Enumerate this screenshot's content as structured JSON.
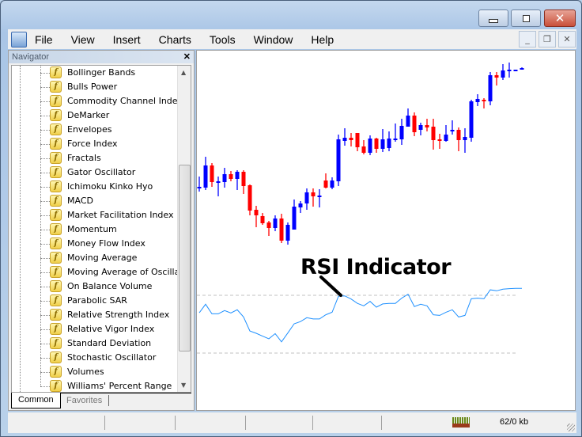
{
  "window": {
    "controls": [
      "minimize",
      "maximize",
      "close"
    ]
  },
  "menu": [
    "File",
    "View",
    "Insert",
    "Charts",
    "Tools",
    "Window",
    "Help"
  ],
  "navigator": {
    "title": "Navigator",
    "items": [
      "Bollinger Bands",
      "Bulls Power",
      "Commodity Channel Index",
      "DeMarker",
      "Envelopes",
      "Force Index",
      "Fractals",
      "Gator Oscillator",
      "Ichimoku Kinko Hyo",
      "MACD",
      "Market Facilitation Index",
      "Momentum",
      "Money Flow Index",
      "Moving Average",
      "Moving Average of Oscillat",
      "On Balance Volume",
      "Parabolic SAR",
      "Relative Strength Index",
      "Relative Vigor Index",
      "Standard Deviation",
      "Stochastic Oscillator",
      "Volumes",
      "Williams' Percent Range"
    ],
    "tabs": [
      "Common",
      "Favorites"
    ],
    "active_tab": "Common"
  },
  "chart": {
    "annotation": "RSI Indicator",
    "colors": {
      "bull": "#0000ff",
      "bear": "#ff0000",
      "rsi": "#1e90ff",
      "level": "#c0c0c0"
    },
    "candles_ohlc": [
      [
        165,
        178,
        159,
        165
      ],
      [
        164,
        203,
        161,
        192
      ],
      [
        192,
        195,
        165,
        171
      ],
      [
        172,
        178,
        153,
        172
      ],
      [
        171,
        189,
        164,
        181
      ],
      [
        181,
        185,
        172,
        175
      ],
      [
        175,
        186,
        161,
        184
      ],
      [
        184,
        186,
        156,
        166
      ],
      [
        167,
        168,
        129,
        135
      ],
      [
        136,
        141,
        114,
        129
      ],
      [
        128,
        132,
        117,
        119
      ],
      [
        120,
        122,
        103,
        113
      ],
      [
        113,
        129,
        109,
        125
      ],
      [
        125,
        131,
        94,
        97
      ],
      [
        97,
        120,
        92,
        117
      ],
      [
        111,
        149,
        111,
        140
      ],
      [
        139,
        147,
        132,
        144
      ],
      [
        144,
        163,
        136,
        158
      ],
      [
        158,
        163,
        140,
        153
      ],
      [
        154,
        162,
        139,
        154
      ],
      [
        173,
        182,
        163,
        164
      ],
      [
        164,
        177,
        162,
        173
      ],
      [
        172,
        231,
        166,
        225
      ],
      [
        223,
        239,
        217,
        227
      ],
      [
        227,
        233,
        216,
        224
      ],
      [
        233,
        233,
        210,
        215
      ],
      [
        216,
        224,
        206,
        208
      ],
      [
        208,
        230,
        205,
        226
      ],
      [
        226,
        227,
        208,
        213
      ],
      [
        213,
        238,
        209,
        225
      ],
      [
        214,
        235,
        210,
        226
      ],
      [
        226,
        245,
        222,
        226
      ],
      [
        225,
        251,
        218,
        242
      ],
      [
        241,
        264,
        241,
        255
      ],
      [
        255,
        259,
        229,
        234
      ],
      [
        237,
        246,
        230,
        243
      ],
      [
        243,
        251,
        235,
        240
      ],
      [
        241,
        251,
        212,
        224
      ],
      [
        225,
        232,
        213,
        223
      ],
      [
        223,
        243,
        222,
        231
      ],
      [
        237,
        249,
        231,
        237
      ],
      [
        237,
        240,
        210,
        224
      ],
      [
        224,
        239,
        208,
        228
      ],
      [
        227,
        275,
        222,
        273
      ],
      [
        272,
        282,
        267,
        276
      ],
      [
        275,
        277,
        264,
        273
      ],
      [
        273,
        310,
        268,
        306
      ],
      [
        306,
        310,
        293,
        303
      ],
      [
        303,
        320,
        300,
        312
      ],
      [
        312,
        322,
        303,
        313
      ],
      [
        312,
        313,
        312,
        313
      ],
      [
        315,
        316,
        313,
        315
      ]
    ],
    "rsi": {
      "levels": [
        70,
        30
      ],
      "values": [
        57.9,
        63.8,
        57.2,
        57.2,
        59.4,
        57.8,
        60.0,
        55.0,
        45.3,
        43.7,
        41.7,
        39.9,
        43.5,
        37.8,
        43.9,
        50.3,
        51.8,
        54.5,
        53.6,
        53.6,
        56.5,
        58.3,
        69.3,
        69.6,
        67.4,
        64.4,
        62.7,
        65.8,
        61.8,
        64.0,
        64.4,
        64.4,
        68.0,
        70.7,
        62.2,
        63.8,
        62.7,
        56.5,
        56.1,
        58.3,
        60.0,
        55.0,
        56.1,
        67.6,
        68.0,
        67.6,
        73.8,
        73.1,
        74.2,
        74.6,
        74.8,
        74.8
      ]
    }
  },
  "status": {
    "traffic": "62/0 kb"
  }
}
